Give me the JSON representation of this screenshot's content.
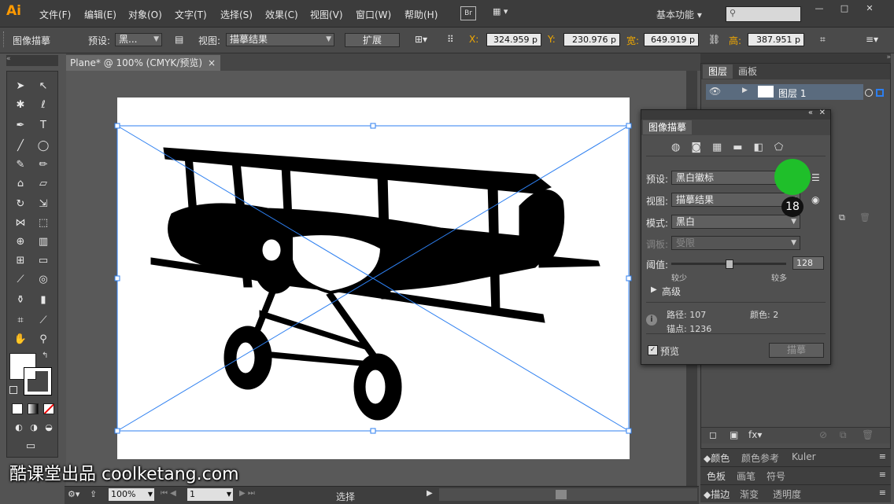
{
  "app": {
    "logo": "Ai"
  },
  "menu": [
    "文件(F)",
    "编辑(E)",
    "对象(O)",
    "文字(T)",
    "选择(S)",
    "效果(C)",
    "视图(V)",
    "窗口(W)",
    "帮助(H)"
  ],
  "bridge_label": "Br",
  "workspace": "基本功能",
  "search_placeholder": "",
  "window_controls": [
    "—",
    "□",
    "✕"
  ],
  "control_bar": {
    "title": "图像描摹",
    "preset_label": "预设:",
    "preset_value": "黑...",
    "view_label": "视图:",
    "view_value": "描摹结果",
    "expand_label": "扩展",
    "x_label": "X:",
    "x_value": "324.959 p",
    "y_label": "Y:",
    "y_value": "230.976 p",
    "w_label": "宽:",
    "w_value": "649.919 p",
    "h_label": "高:",
    "h_value": "387.951 p"
  },
  "document_tab": {
    "title": "Plane* @ 100% (CMYK/预览)",
    "close": "×"
  },
  "status_bar": {
    "zoom": "100%",
    "page": "1",
    "tool": "选择"
  },
  "layers_panel": {
    "tabs": [
      "图层",
      "画板"
    ],
    "layer_name": "图层 1",
    "bottom_tabs_1": [
      "颜色",
      "颜色参考",
      "Kuler"
    ],
    "bottom_tabs_2": [
      "色板",
      "画笔",
      "符号"
    ],
    "bottom_tabs_3": [
      "描边",
      "渐变",
      "透明度"
    ]
  },
  "trace_panel": {
    "title": "图像描摹",
    "preset_label": "预设:",
    "preset_value": "黑白徽标",
    "view_label": "视图:",
    "view_value": "描摹结果",
    "mode_label": "模式:",
    "mode_value": "黑白",
    "palette_label": "调板:",
    "palette_value": "受限",
    "threshold_label": "阈值:",
    "threshold_value": "128",
    "threshold_fraction": 0.5,
    "less_label": "较少",
    "more_label": "较多",
    "advanced_label": "高级",
    "paths_label": "路径: 107",
    "colors_label": "颜色: 2",
    "anchors_label": "锚点: 1236",
    "preview_label": "预览",
    "trace_button": "描摹"
  },
  "step_badge": "18",
  "watermark": "酷课堂出品 coolketang.com",
  "colors": {
    "accent": "#1fbf2a",
    "logo": "#ff9a00",
    "selection": "#2d7ff0"
  }
}
